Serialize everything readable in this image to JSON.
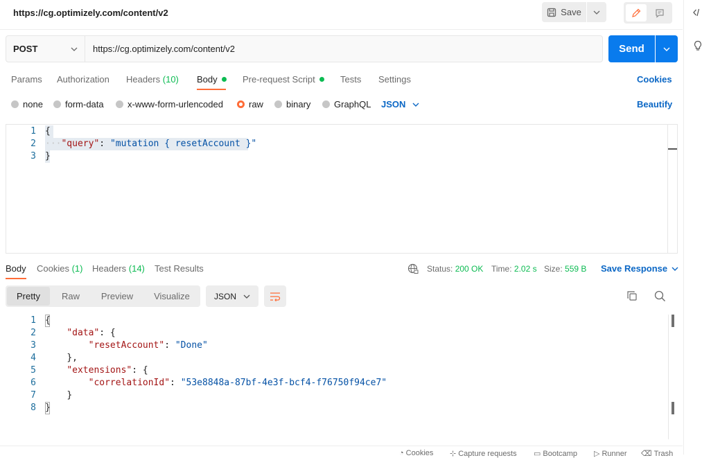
{
  "header": {
    "title": "https://cg.optimizely.com/content/v2",
    "save_label": "Save"
  },
  "request": {
    "method": "POST",
    "url": "https://cg.optimizely.com/content/v2",
    "send_label": "Send"
  },
  "req_tabs": {
    "params": "Params",
    "authorization": "Authorization",
    "headers": "Headers",
    "headers_count": "(10)",
    "body": "Body",
    "prerequest": "Pre-request Script",
    "tests": "Tests",
    "settings": "Settings",
    "cookies": "Cookies"
  },
  "body_options": {
    "none": "none",
    "form_data": "form-data",
    "urlencoded": "x-www-form-urlencoded",
    "raw": "raw",
    "binary": "binary",
    "graphql": "GraphQL",
    "language": "JSON",
    "beautify": "Beautify",
    "selected": "raw"
  },
  "request_body": {
    "line_numbers": [
      "1",
      "2",
      "3"
    ],
    "l1": "{",
    "l2_key": "\"query\"",
    "l2_colon": ": ",
    "l2_value": "\"mutation { resetAccount }\"",
    "l3": "}"
  },
  "response_tabs": {
    "body": "Body",
    "cookies": "Cookies",
    "cookies_count": "(1)",
    "headers": "Headers",
    "headers_count": "(14)",
    "test_results": "Test Results"
  },
  "response_meta": {
    "status_label": "Status:",
    "status_value": "200 OK",
    "time_label": "Time:",
    "time_value": "2.02 s",
    "size_label": "Size:",
    "size_value": "559 B",
    "save_response": "Save Response"
  },
  "response_view": {
    "pretty": "Pretty",
    "raw": "Raw",
    "preview": "Preview",
    "visualize": "Visualize",
    "language": "JSON"
  },
  "response_body": {
    "line_numbers": [
      "1",
      "2",
      "3",
      "4",
      "5",
      "6",
      "7",
      "8"
    ],
    "l1": "{",
    "l2_key": "\"data\"",
    "l2_rest": ": {",
    "l3_key": "\"resetAccount\"",
    "l3_colon": ": ",
    "l3_value": "\"Done\"",
    "l4": "},",
    "l5_key": "\"extensions\"",
    "l5_rest": ": {",
    "l6_key": "\"correlationId\"",
    "l6_colon": ": ",
    "l6_value": "\"53e8848a-87bf-4e3f-bcf4-f76750f94ce7\"",
    "l7": "}",
    "l8": "}"
  },
  "footer": {
    "cookies": "Cookies",
    "capture": "Capture requests",
    "bootcamp": "Bootcamp",
    "runner": "Runner",
    "trash": "Trash"
  },
  "colors": {
    "accent": "#ff6c37",
    "primary": "#097bed",
    "success": "#0cbb52",
    "link": "#0b67c5"
  }
}
